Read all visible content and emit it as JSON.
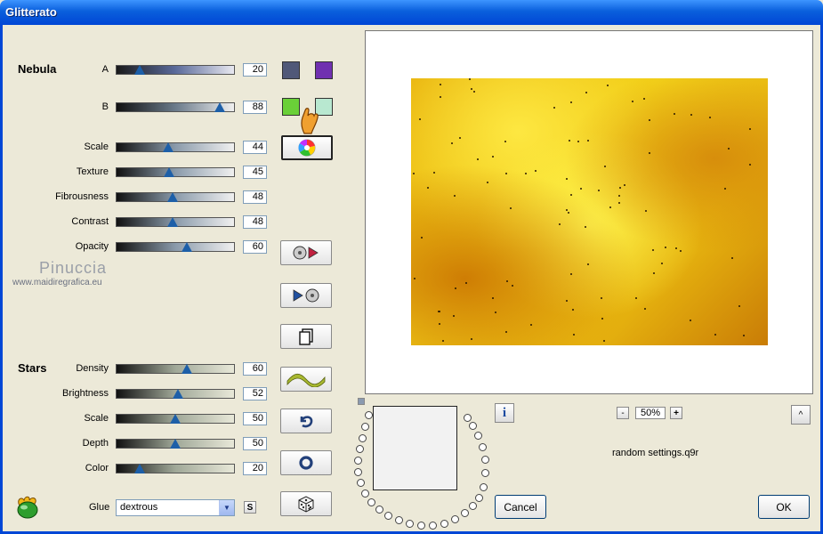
{
  "window": {
    "title": "Glitterato"
  },
  "nebula": {
    "heading": "Nebula",
    "sliders": [
      {
        "key": "a",
        "label": "A",
        "value": "20",
        "level": 20,
        "gradient": [
          "#1a1a1a",
          "#5a6a9a",
          "#e8e8f0"
        ]
      },
      {
        "key": "b",
        "label": "B",
        "value": "88",
        "level": 88,
        "gradient": [
          "#111111",
          "#6a7a8a",
          "#f0f0f0"
        ]
      },
      {
        "key": "scale",
        "label": "Scale",
        "value": "44",
        "level": 44,
        "gradient": [
          "#111111",
          "#8a9aaa",
          "#f0f0f0"
        ]
      },
      {
        "key": "texture",
        "label": "Texture",
        "value": "45",
        "level": 45,
        "gradient": [
          "#111111",
          "#8a9aaa",
          "#f0f0f0"
        ]
      },
      {
        "key": "fibrousness",
        "label": "Fibrousness",
        "value": "48",
        "level": 48,
        "gradient": [
          "#111111",
          "#8a9aaa",
          "#f0f0f0"
        ]
      },
      {
        "key": "contrast",
        "label": "Contrast",
        "value": "48",
        "level": 48,
        "gradient": [
          "#111111",
          "#8a9aaa",
          "#f0f0f0"
        ]
      },
      {
        "key": "opacity",
        "label": "Opacity",
        "value": "60",
        "level": 60,
        "gradient": [
          "#111111",
          "#8a9aaa",
          "#f0f0f0"
        ]
      }
    ],
    "colors": {
      "a1": "#505878",
      "a2": "#7030b0",
      "b1": "#6ad038",
      "b2": "#b8e8d0"
    }
  },
  "stars": {
    "heading": "Stars",
    "sliders": [
      {
        "key": "density",
        "label": "Density",
        "value": "60",
        "level": 60,
        "gradient": [
          "#111111",
          "#a0a898",
          "#e8e8d8"
        ]
      },
      {
        "key": "brightness",
        "label": "Brightness",
        "value": "52",
        "level": 52,
        "gradient": [
          "#111111",
          "#a0a898",
          "#e8e8d8"
        ]
      },
      {
        "key": "scale",
        "label": "Scale",
        "value": "50",
        "level": 50,
        "gradient": [
          "#111111",
          "#a0a898",
          "#e8e8d8"
        ]
      },
      {
        "key": "depth",
        "label": "Depth",
        "value": "50",
        "level": 50,
        "gradient": [
          "#111111",
          "#a0a898",
          "#e8e8d8"
        ]
      },
      {
        "key": "color",
        "label": "Color",
        "value": "20",
        "level": 20,
        "gradient": [
          "#111111",
          "#a0a898",
          "#e8e8d8"
        ]
      }
    ]
  },
  "glue": {
    "label": "Glue",
    "value": "dextrous",
    "s_button": "S"
  },
  "watermark": {
    "name": "Pinuccia",
    "url": "www.maidiregrafica.eu"
  },
  "zoom": {
    "value": "50%",
    "minus": "-",
    "plus": "+"
  },
  "preset_name": "random settings.q9r",
  "buttons": {
    "cancel": "Cancel",
    "ok": "OK",
    "info": "i",
    "collapse": "^"
  },
  "icons": {
    "color_wheel": "color-wheel-icon",
    "load": "load-preset-icon",
    "save": "save-preset-icon",
    "copy": "copy-icon",
    "wave": "wave-icon",
    "undo": "undo-icon",
    "reset": "reset-icon",
    "random": "dice-icon",
    "app": "app-logo-icon"
  }
}
